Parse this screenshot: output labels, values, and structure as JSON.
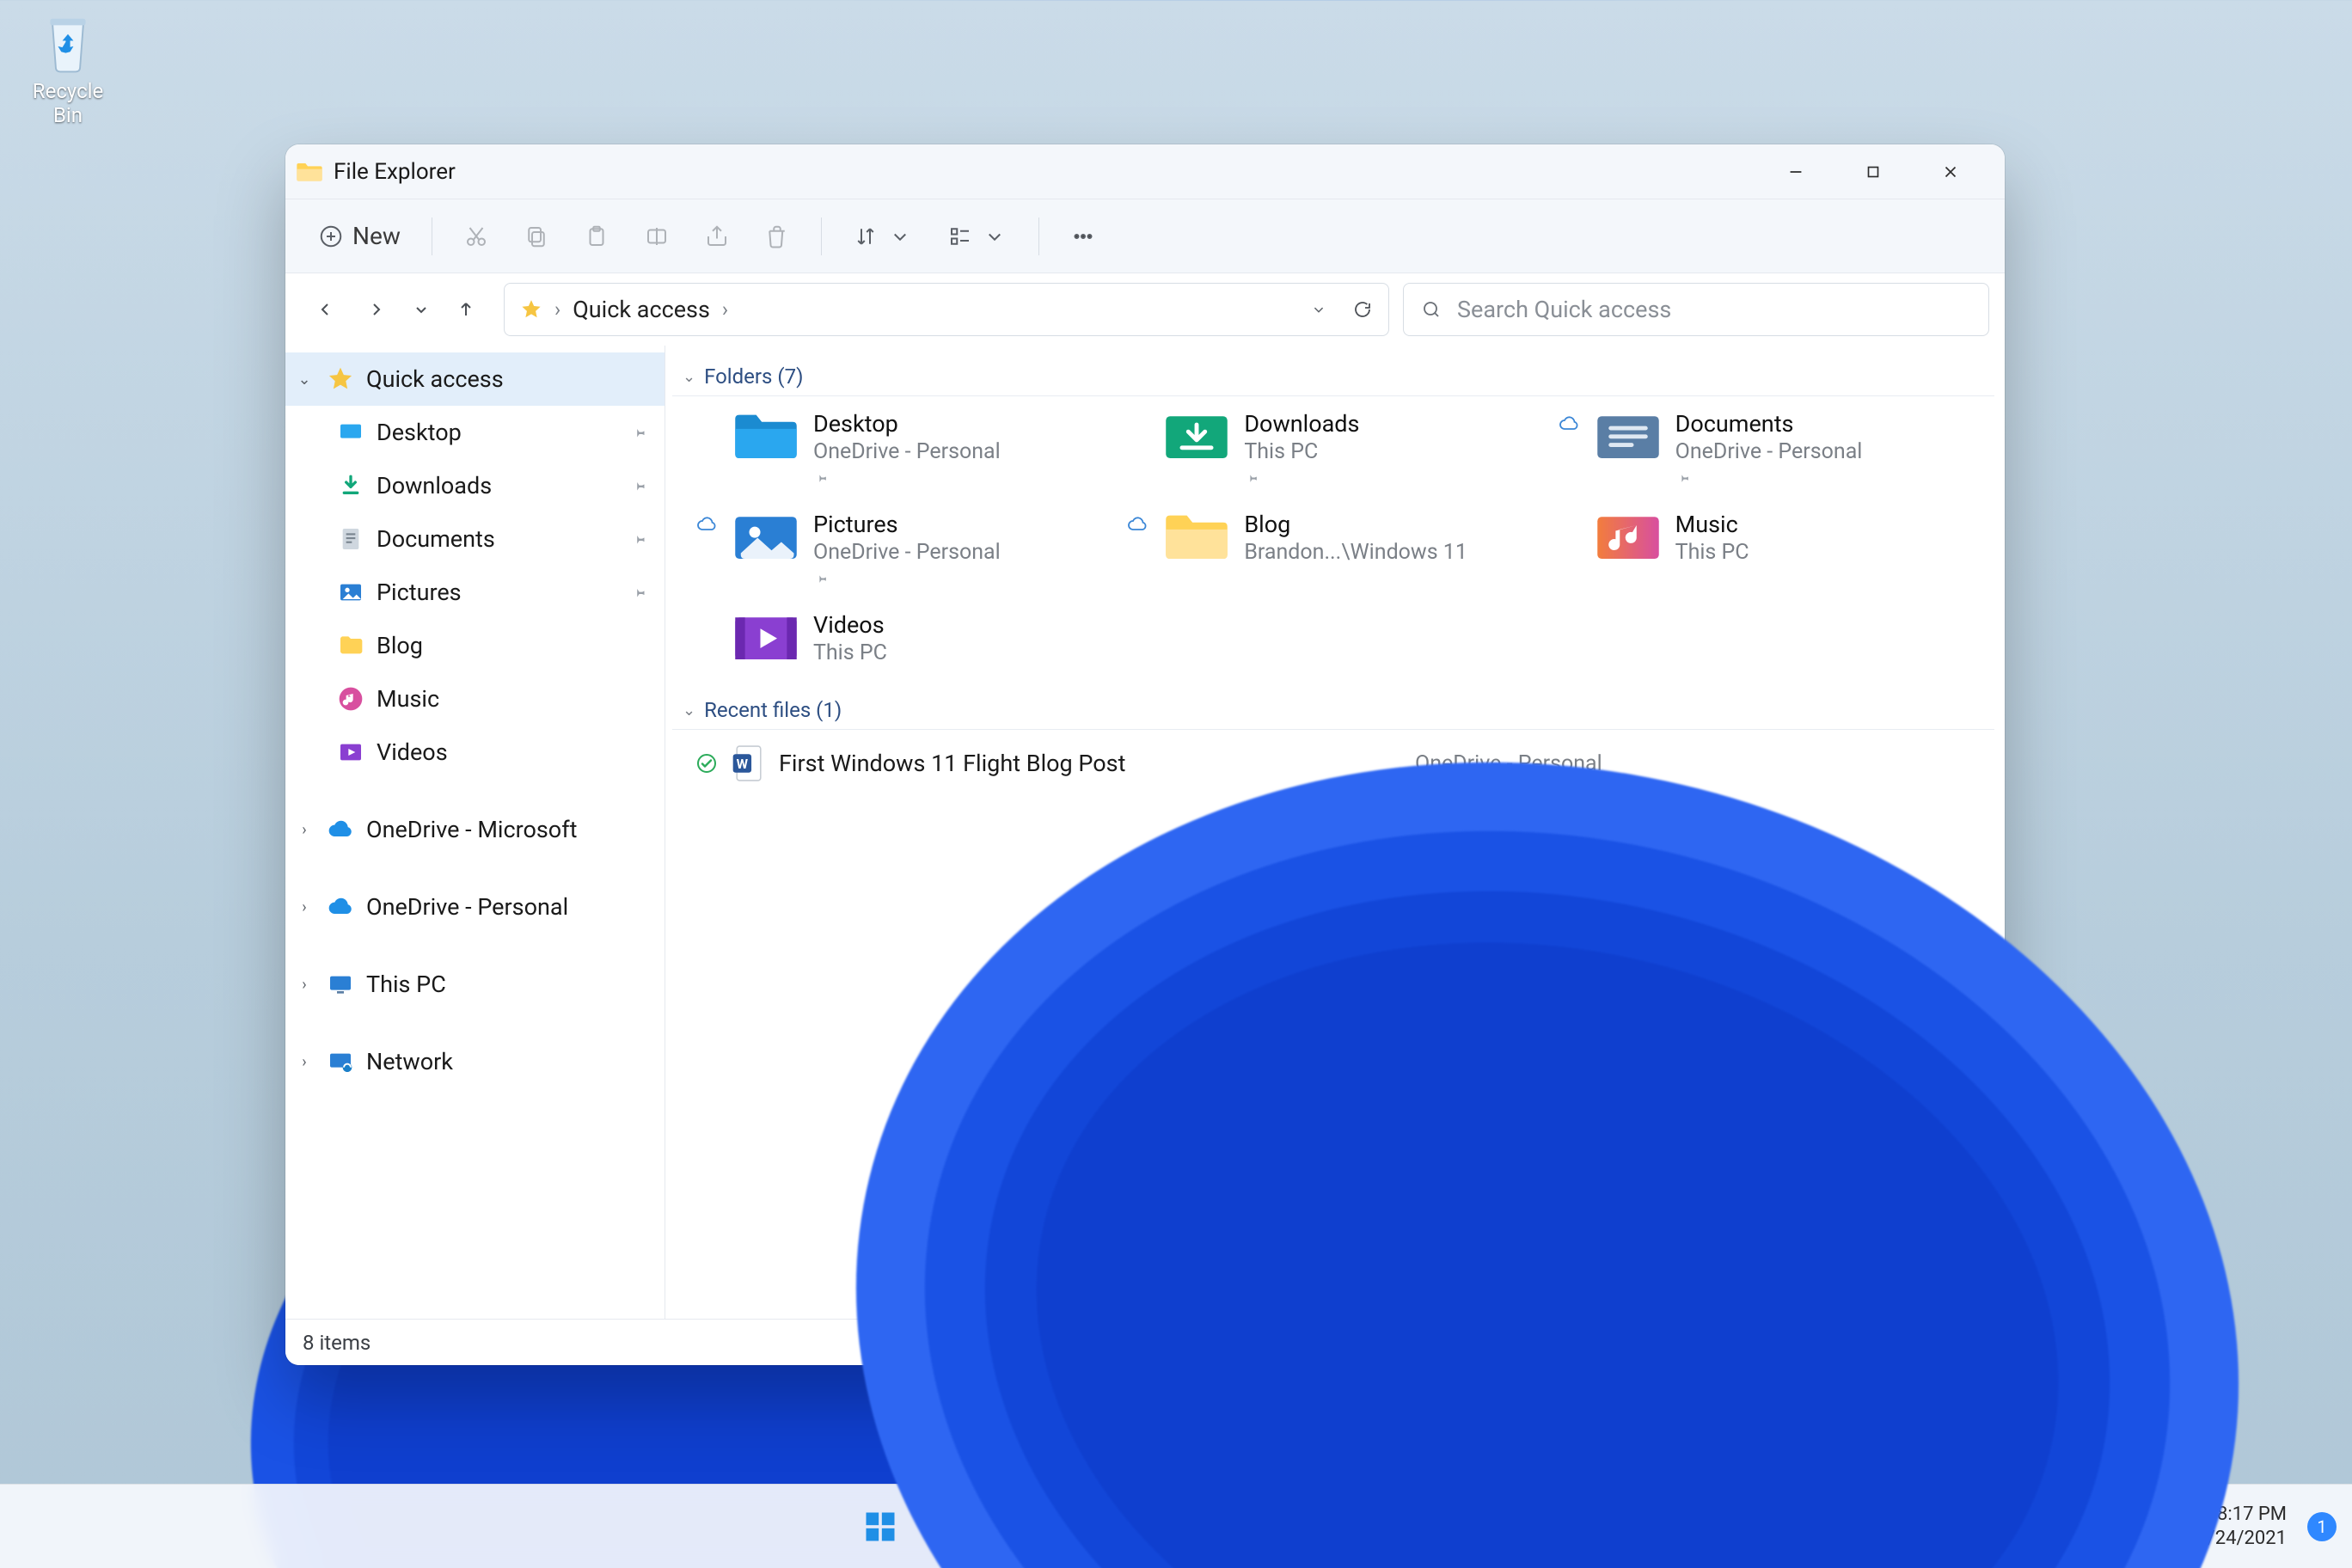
{
  "desktop": {
    "recycle_bin": "Recycle Bin"
  },
  "window": {
    "title": "File Explorer",
    "toolbar": {
      "new_label": "New"
    },
    "address": {
      "location": "Quick access"
    },
    "search": {
      "placeholder": "Search Quick access"
    },
    "sidebar": {
      "quick_access": "Quick access",
      "items": [
        {
          "label": "Desktop",
          "pinned": true
        },
        {
          "label": "Downloads",
          "pinned": true
        },
        {
          "label": "Documents",
          "pinned": true
        },
        {
          "label": "Pictures",
          "pinned": true
        },
        {
          "label": "Blog",
          "pinned": false
        },
        {
          "label": "Music",
          "pinned": false
        },
        {
          "label": "Videos",
          "pinned": false
        }
      ],
      "roots": [
        {
          "label": "OneDrive - Microsoft"
        },
        {
          "label": "OneDrive - Personal"
        },
        {
          "label": "This PC"
        },
        {
          "label": "Network"
        }
      ]
    },
    "groups": {
      "folders": {
        "label": "Folders (7)"
      },
      "recent": {
        "label": "Recent files (1)"
      }
    },
    "folders": [
      {
        "name": "Desktop",
        "sub": "OneDrive - Personal",
        "pinned": true
      },
      {
        "name": "Downloads",
        "sub": "This PC",
        "pinned": true
      },
      {
        "name": "Documents",
        "sub": "OneDrive - Personal",
        "pinned": true
      },
      {
        "name": "Pictures",
        "sub": "OneDrive - Personal",
        "pinned": true
      },
      {
        "name": "Blog",
        "sub": "Brandon...\\Windows 11",
        "pinned": false
      },
      {
        "name": "Music",
        "sub": "This PC",
        "pinned": false
      },
      {
        "name": "Videos",
        "sub": "This PC",
        "pinned": false
      }
    ],
    "recent_files": [
      {
        "name": "First Windows 11 Flight Blog Post",
        "location": "OneDrive - Personal"
      }
    ],
    "status": {
      "count": "8 items"
    }
  },
  "taskbar": {
    "time": "8:17 PM",
    "date": "6/24/2021",
    "notif_count": "1"
  }
}
